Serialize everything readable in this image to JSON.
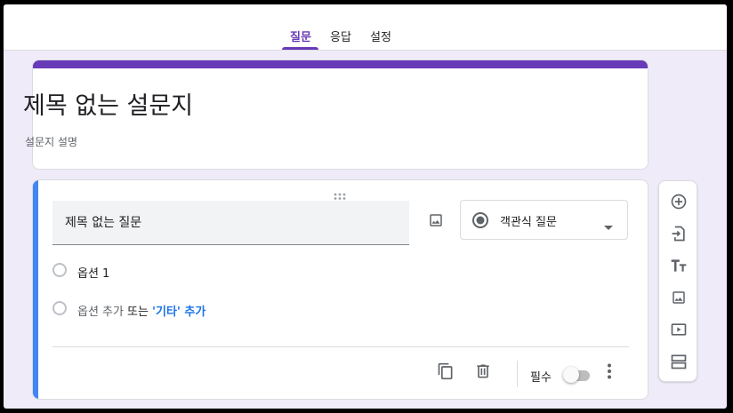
{
  "tabs": [
    {
      "label": "질문",
      "active": true
    },
    {
      "label": "응답",
      "active": false
    },
    {
      "label": "설정",
      "active": false
    }
  ],
  "form": {
    "title": "제목 없는 설문지",
    "description": "설문지 설명"
  },
  "question": {
    "title": "제목 없는 질문",
    "type_label": "객관식 질문",
    "options": [
      "옵션 1"
    ],
    "add_option_label": "옵션 추가",
    "or_label": "또는",
    "add_other_label": "'기타' 추가",
    "required_label": "필수",
    "required": false
  },
  "colors": {
    "accent": "#673ab7",
    "question_bar": "#4285f4",
    "link": "#1a73e8",
    "background": "#f0ebf8"
  },
  "side_toolbar": [
    "add-question-icon",
    "import-questions-icon",
    "add-title-icon",
    "add-image-icon",
    "add-video-icon",
    "add-section-icon"
  ]
}
